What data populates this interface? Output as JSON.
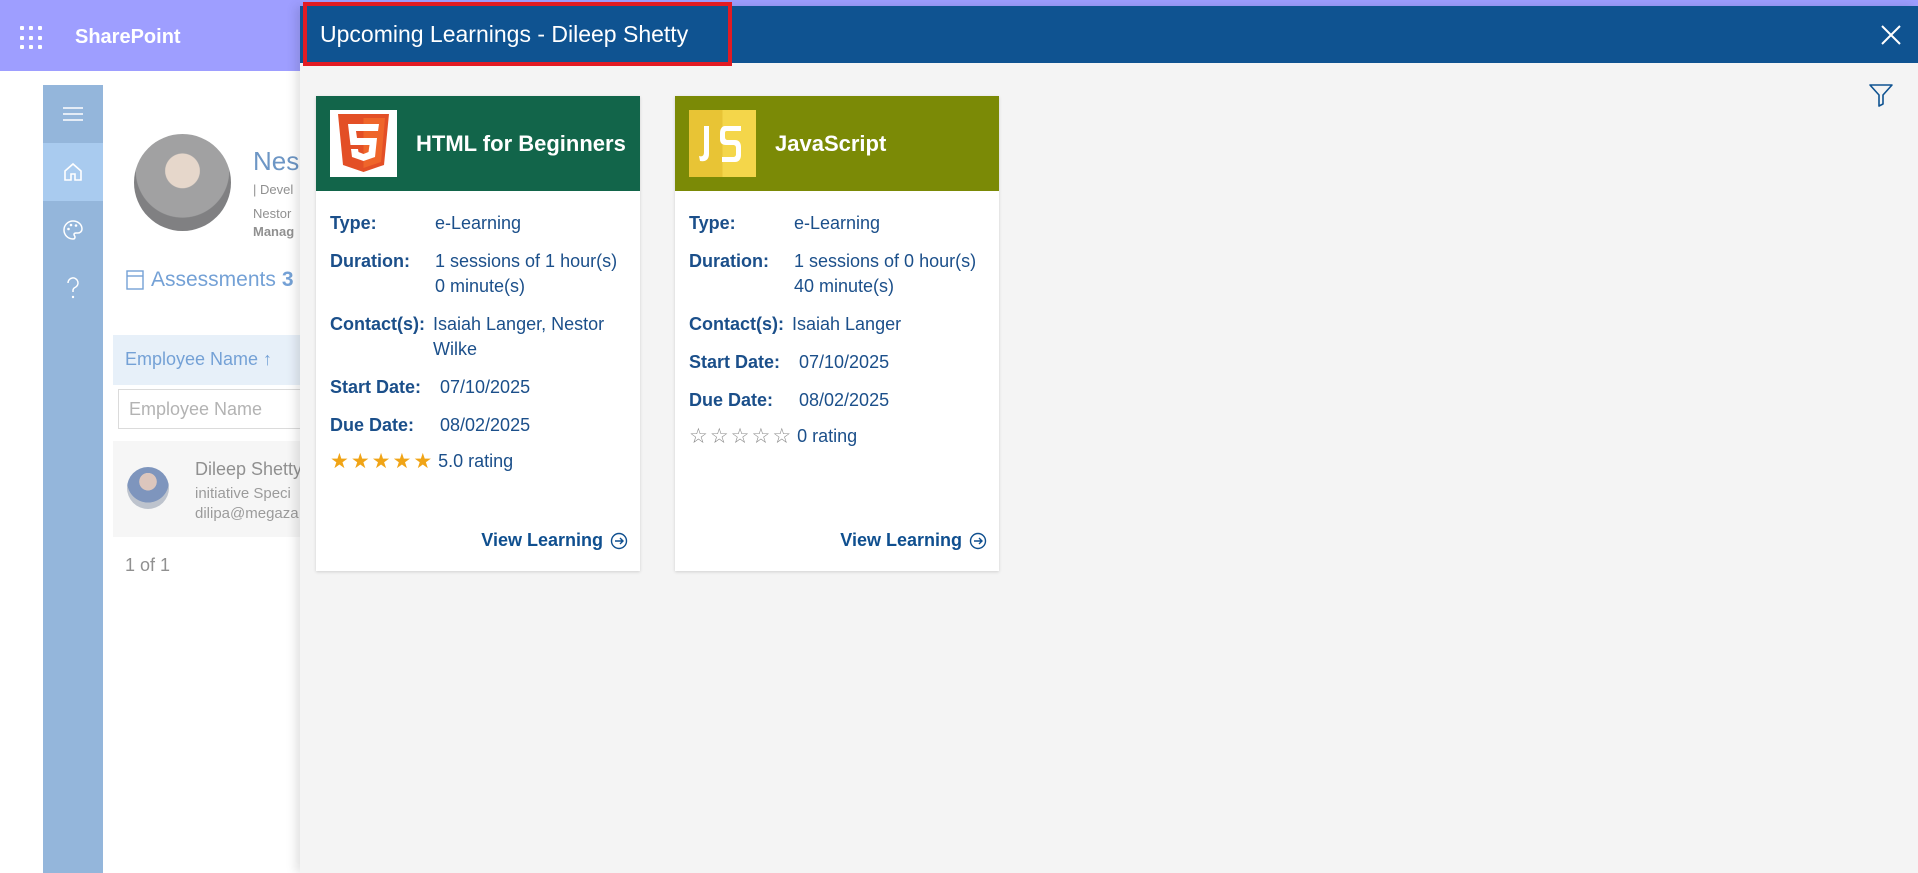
{
  "suite": {
    "app_name": "SharePoint"
  },
  "background": {
    "employee_name_header": "Nes",
    "employee_meta": [
      "| Devel",
      "Nestor",
      "Manag"
    ],
    "assessments_label": "Assessments",
    "assessments_count": "3",
    "grid": {
      "column_header": "Employee Name ↑",
      "filter_placeholder": "Employee Name",
      "row": {
        "name": "Dileep Shetty",
        "title": "initiative Speci",
        "email": "dilipa@megaza"
      },
      "pager": "1 of 1"
    }
  },
  "panel": {
    "title": "Upcoming Learnings - Dileep Shetty",
    "cards": [
      {
        "title": "HTML for Beginners",
        "logo": "html5-logo",
        "header_color": "#12654a",
        "type_label": "Type:",
        "type": "e-Learning",
        "duration_label": "Duration:",
        "duration": "1 sessions of 1 hour(s) 0 minute(s)",
        "contacts_label": "Contact(s):",
        "contacts": "Isaiah Langer, Nestor Wilke",
        "start_label": "Start Date:",
        "start": "07/10/2025",
        "due_label": "Due Date:",
        "due": "08/02/2025",
        "rating_value": 5,
        "rating_text": "5.0 rating",
        "link": "View Learning"
      },
      {
        "title": "JavaScript",
        "logo": "js-logo",
        "header_color": "#7b8a06",
        "type_label": "Type:",
        "type": "e-Learning",
        "duration_label": "Duration:",
        "duration": "1 sessions of 0 hour(s) 40 minute(s)",
        "contacts_label": "Contact(s):",
        "contacts": "Isaiah Langer",
        "start_label": "Start Date:",
        "start": "07/10/2025",
        "due_label": "Due Date:",
        "due": "08/02/2025",
        "rating_value": 0,
        "rating_text": "0 rating",
        "link": "View Learning"
      }
    ]
  }
}
